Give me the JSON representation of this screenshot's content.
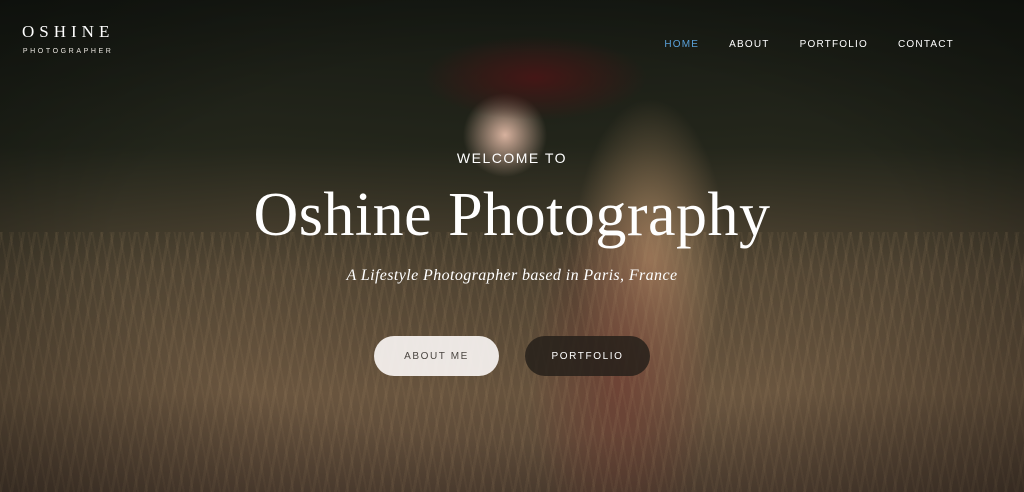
{
  "brand": {
    "title": "OSHINE",
    "subtitle": "PHOTOGRAPHER"
  },
  "nav": {
    "items": [
      {
        "label": "HOME",
        "active": true
      },
      {
        "label": "ABOUT",
        "active": false
      },
      {
        "label": "PORTFOLIO",
        "active": false
      },
      {
        "label": "CONTACT",
        "active": false
      }
    ],
    "active_color": "#5aa0d8"
  },
  "hero": {
    "eyebrow": "WELCOME TO",
    "headline": "Oshine Photography",
    "tagline": "A Lifestyle Photographer based in Paris, France",
    "buttons": {
      "primary": "ABOUT ME",
      "secondary": "PORTFOLIO"
    },
    "background_image": "woman-in-brown-hat-in-tall-grass"
  }
}
